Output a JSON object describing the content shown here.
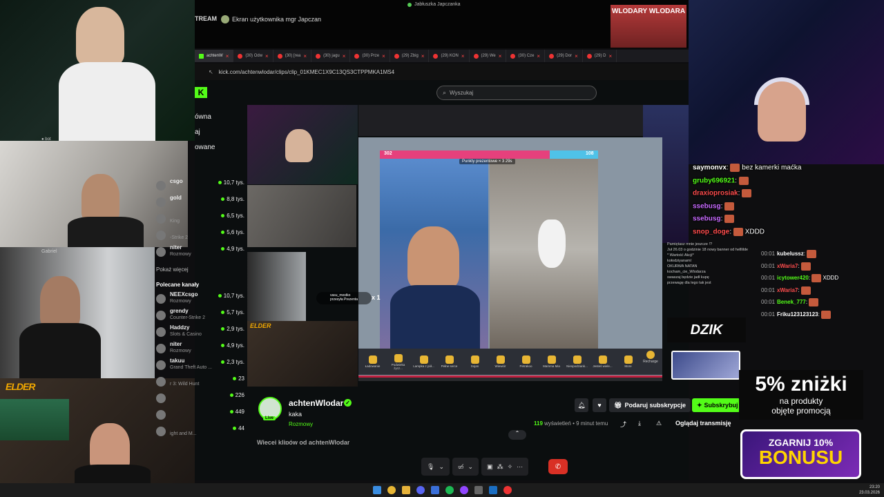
{
  "top_bar": {
    "stream_label": "TREAM",
    "screen_share_label": "Ekran użytkownika mgr Japczan",
    "window_title": "Jabłuszka Japczanka"
  },
  "tabs": [
    {
      "label": "achtenW",
      "active": true
    },
    {
      "label": "(30) Odw",
      "active": false
    },
    {
      "label": "(30) [rea",
      "active": false
    },
    {
      "label": "(30) jagu",
      "active": false
    },
    {
      "label": "(30) Prze",
      "active": false
    },
    {
      "label": "(29) Zbig",
      "active": false
    },
    {
      "label": "(29) KON",
      "active": false
    },
    {
      "label": "(29) We",
      "active": false
    },
    {
      "label": "(30) Cze",
      "active": false
    },
    {
      "label": "(29) Dor",
      "active": false
    },
    {
      "label": "(29) D",
      "active": false
    }
  ],
  "url": "kick.com/achtenwlodar/clips/clip_01KMEC1X9C13QS3CTPPMKA1MS4",
  "search": {
    "placeholder": "Wyszukaj"
  },
  "poster_text": "WLODARY WLODARA",
  "sidebar": {
    "nav": [
      "ówna",
      "aj",
      "owane"
    ],
    "show_more": "Pokaż więcej",
    "recommended_header": "Polecane kanały",
    "top_list": [
      {
        "name": "csgo",
        "category": "",
        "viewers": "10,7 tys."
      },
      {
        "name": "gold",
        "category": "",
        "viewers": "8,8 tys."
      },
      {
        "name": "",
        "category": "King",
        "viewers": "6,5 tys."
      },
      {
        "name": "",
        "category": "-Strike 2",
        "viewers": "5,6 tys."
      },
      {
        "name": "niter",
        "category": "Rozmowy",
        "viewers": "4,9 tys."
      }
    ],
    "recommended": [
      {
        "name": "NEEXcsgo",
        "category": "Rozmowy",
        "viewers": "10,7 tys."
      },
      {
        "name": "grendy",
        "category": "Counter-Strike 2",
        "viewers": "5,7 tys."
      },
      {
        "name": "Haddzy",
        "category": "Slots & Casino",
        "viewers": "2,9 tys."
      },
      {
        "name": "niter",
        "category": "Rozmowy",
        "viewers": "4,9 tys."
      },
      {
        "name": "takuu",
        "category": "Grand Theft Auto ...",
        "viewers": "2,3 tys."
      }
    ],
    "lower_list": [
      {
        "name": "",
        "category": "r 3: Wild Hunt",
        "viewers": "23"
      },
      {
        "name": "",
        "category": "",
        "viewers": "226"
      },
      {
        "name": "",
        "category": "",
        "viewers": "449"
      },
      {
        "name": "",
        "category": "ight and M...",
        "viewers": "44"
      }
    ]
  },
  "pk_battle": {
    "left_score": "302",
    "right_score": "108",
    "middle_label": "Punkty prezentowe × 3  29s",
    "left_fraction": 0.78
  },
  "gifts": [
    "Ładowanie",
    "Podwieka życz...",
    "Lampka z pół...",
    "Pełne serce",
    "Sojan",
    "Wiewiór",
    "Petrakoo",
    "Mamma Mia",
    "Niespodziank...",
    "Jesteś wiele...",
    "More"
  ],
  "recharge": "Recharge",
  "gift_notification": {
    "user": "vasu_mostko",
    "text": "przesyła Prezenta",
    "count": "x 1"
  },
  "gabriel_label": "Gabriel",
  "elder_label": "ELDER",
  "dzik_label": "DZIK",
  "mid_chat": [
    "Pamiętasz mnie jeszcze !?",
    "Juł 26.03 o godzinie 18 nowy banner od helllilde * Wartość Akcji*",
    "kołodziyanaml",
    "OKURWA NATAN",
    "kocham_cie_Wlodarza",
    "swaszaj będzie jadł kupę",
    "przewagę dla lego tak jest"
  ],
  "right_chat": [
    {
      "user": "saymonvx",
      "text": "bez kamerki maćka",
      "color": "#ffffff"
    },
    {
      "user": "gruby696921",
      "text": "",
      "color": "#53fc18"
    },
    {
      "user": "draxioprosiak",
      "text": "",
      "color": "#ff4d4d"
    },
    {
      "user": "ssebusg",
      "text": "",
      "color": "#c86bff"
    },
    {
      "user": "ssebusg",
      "text": "",
      "color": "#c86bff"
    },
    {
      "user": "snop_doge",
      "text": "XDDD",
      "color": "#ff4d4d"
    }
  ],
  "right_chat2": [
    {
      "time": "00:01",
      "user": "kubelussz",
      "text": "",
      "color": "#ffffff"
    },
    {
      "time": "00:01",
      "user": "xWaria7",
      "text": "",
      "color": "#ff4d4d"
    },
    {
      "time": "00:01",
      "user": "icytower420",
      "text": "XDDD",
      "color": "#53fc18"
    },
    {
      "time": "00:01",
      "user": "xWaria7",
      "text": "",
      "color": "#ff4d4d"
    },
    {
      "time": "00:01",
      "user": "Benek_777",
      "text": "",
      "color": "#53fc18"
    },
    {
      "time": "00:01",
      "user": "Friku123123123",
      "text": "",
      "color": "#ffffff"
    }
  ],
  "channel": {
    "name": "achtenWlodar",
    "title": "kaka",
    "category": "Rozmowy",
    "live": "Live",
    "views_count": "119",
    "views_text": "wyświetleń",
    "time_ago": "• 9 minut temu",
    "gift_sub": "Podaruj subskrypcje",
    "subscribe": "Subskrybuj",
    "watch_stream": "Oglądaj transmisję",
    "more_clips": "Więcej klipów od achtenWlodar"
  },
  "promo": {
    "discount": "5% zniżki",
    "line1": "na produkty",
    "line2": "objęte promocją",
    "grab": "ZGARNIJ 10%",
    "bonus": "BONUSU"
  },
  "clock": {
    "time": "23:20",
    "date": "23.03.2026"
  },
  "colors": {
    "kick_green": "#53fc18",
    "end_call": "#d93025"
  }
}
